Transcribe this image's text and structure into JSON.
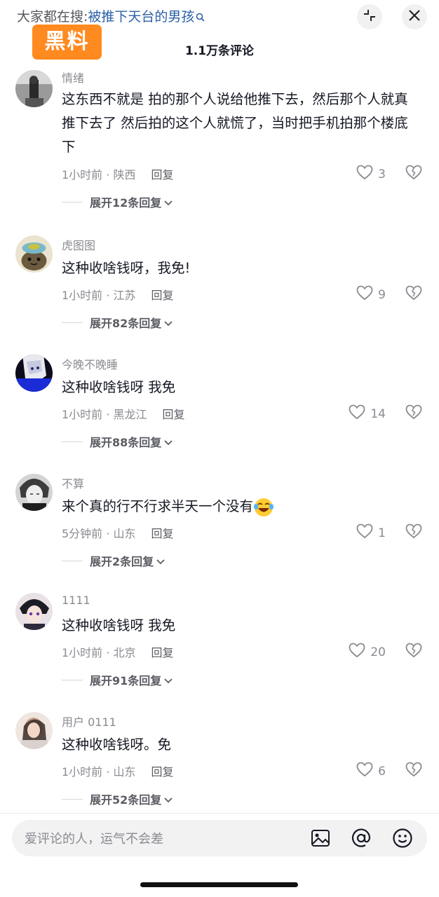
{
  "header": {
    "search_prefix": "大家都在搜:",
    "search_query": "被推下天台的男孩",
    "watermark": "黑料",
    "comment_count": "1.1万条评论"
  },
  "comments": [
    {
      "username": "情绪",
      "text": "这东西不就是 拍的那个人说给他推下去，然后那个人就真推下去了 然后拍的这个人就慌了，当时把手机拍那个楼底下",
      "time_location": "1小时前 · 陕西",
      "reply": "回复",
      "likes": "3",
      "expand": "展开12条回复"
    },
    {
      "username": "虎图图",
      "text": "这种收啥钱呀，我免!",
      "time_location": "1小时前 · 江苏",
      "reply": "回复",
      "likes": "9",
      "expand": "展开82条回复"
    },
    {
      "username": "今晚不晚睡",
      "text": "这种收啥钱呀 我免",
      "time_location": "1小时前 · 黑龙江",
      "reply": "回复",
      "likes": "14",
      "expand": "展开88条回复"
    },
    {
      "username": "不算",
      "text": "来个真的行不行求半天一个没有",
      "time_location": "5分钟前 · 山东",
      "reply": "回复",
      "likes": "1",
      "expand": "展开2条回复"
    },
    {
      "username": "1111",
      "text": "这种收啥钱呀 我免",
      "time_location": "1小时前 · 北京",
      "reply": "回复",
      "likes": "20",
      "expand": "展开91条回复"
    },
    {
      "username": "用户 0111",
      "text": "这种收啥钱呀。免",
      "time_location": "1小时前 · 山东",
      "reply": "回复",
      "likes": "6",
      "expand": "展开52条回复"
    }
  ],
  "bottom_bar": {
    "placeholder": "爱评论的人，运气不会差"
  },
  "icons": {
    "search": "search-icon",
    "collapse": "collapse-icon",
    "close": "close-icon",
    "like": "heart-icon",
    "dislike": "broken-heart-icon",
    "image": "image-icon",
    "mention": "at-icon",
    "emoji": "emoji-icon"
  },
  "colors": {
    "watermark_bg": "#ff8a1f",
    "query_link": "#2b5fa8",
    "muted_text": "#8a8b91"
  }
}
